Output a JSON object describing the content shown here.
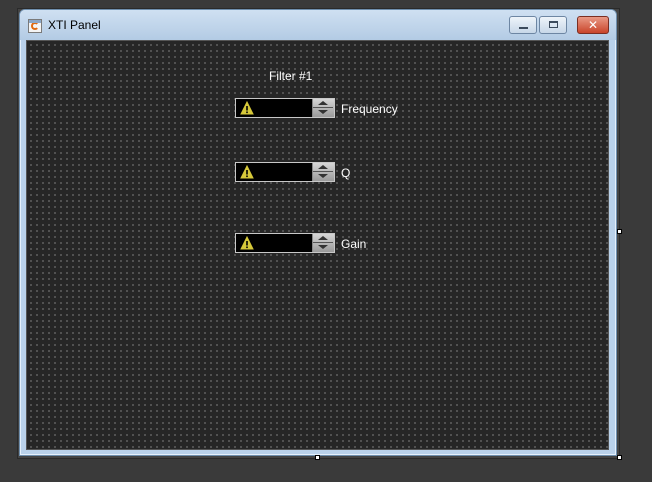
{
  "window": {
    "title": "XTI Panel",
    "icon": "app-icon"
  },
  "caption_buttons": {
    "minimize_icon": "minimize-icon",
    "maximize_icon": "maximize-icon",
    "close_icon": "close-icon",
    "close_glyph": "✕"
  },
  "panel": {
    "filter_title": "Filter #1",
    "fields": [
      {
        "label": "Frequency",
        "status_icon": "warning-icon"
      },
      {
        "label": "Q",
        "status_icon": "warning-icon"
      },
      {
        "label": "Gain",
        "status_icon": "warning-icon"
      }
    ]
  },
  "colors": {
    "client_background": "#262626",
    "grid_dots": "#8a8a8a",
    "warning": "#d6c83a",
    "close_button": "#c9442a"
  }
}
